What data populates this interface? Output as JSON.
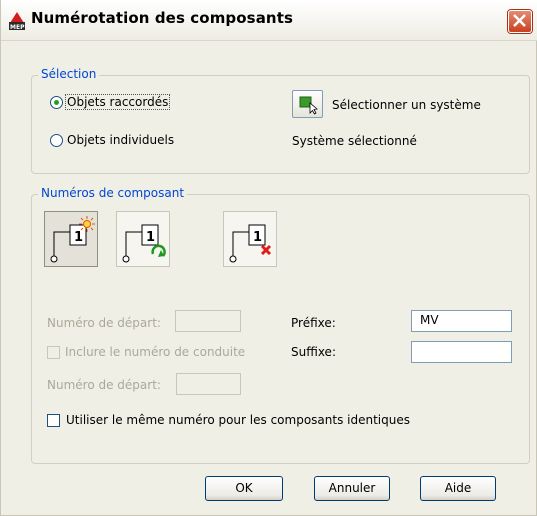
{
  "dialog": {
    "title": "Numérotation des composants"
  },
  "selection": {
    "legend": "Sélection",
    "radio_connected": "Objets raccordés",
    "radio_individual": "Objets individuels",
    "select_system_label": "Sélectionner un système",
    "selected_system_label": "Système sélectionné"
  },
  "numbers": {
    "legend": "Numéros de composant",
    "tools": [
      {
        "icon": "new-numbering-icon"
      },
      {
        "icon": "renumber-icon"
      },
      {
        "icon": "delete-number-icon"
      }
    ],
    "start_number_label": "Numéro de départ:",
    "start_number_value": "",
    "include_run_number_label": "Inclure le numéro de conduite",
    "start_number2_label": "Numéro de départ:",
    "start_number2_value": "",
    "prefix_label": "Préfixe:",
    "prefix_value": "MV",
    "suffix_label": "Suffixe:",
    "suffix_value": "",
    "same_number_label": "Utiliser le même numéro pour les composants identiques"
  },
  "buttons": {
    "ok": "OK",
    "cancel": "Annuler",
    "help": "Aide"
  },
  "colors": {
    "legend": "#0046d5",
    "dialog_bg": "#f0efe6",
    "close": "#c9401f"
  }
}
